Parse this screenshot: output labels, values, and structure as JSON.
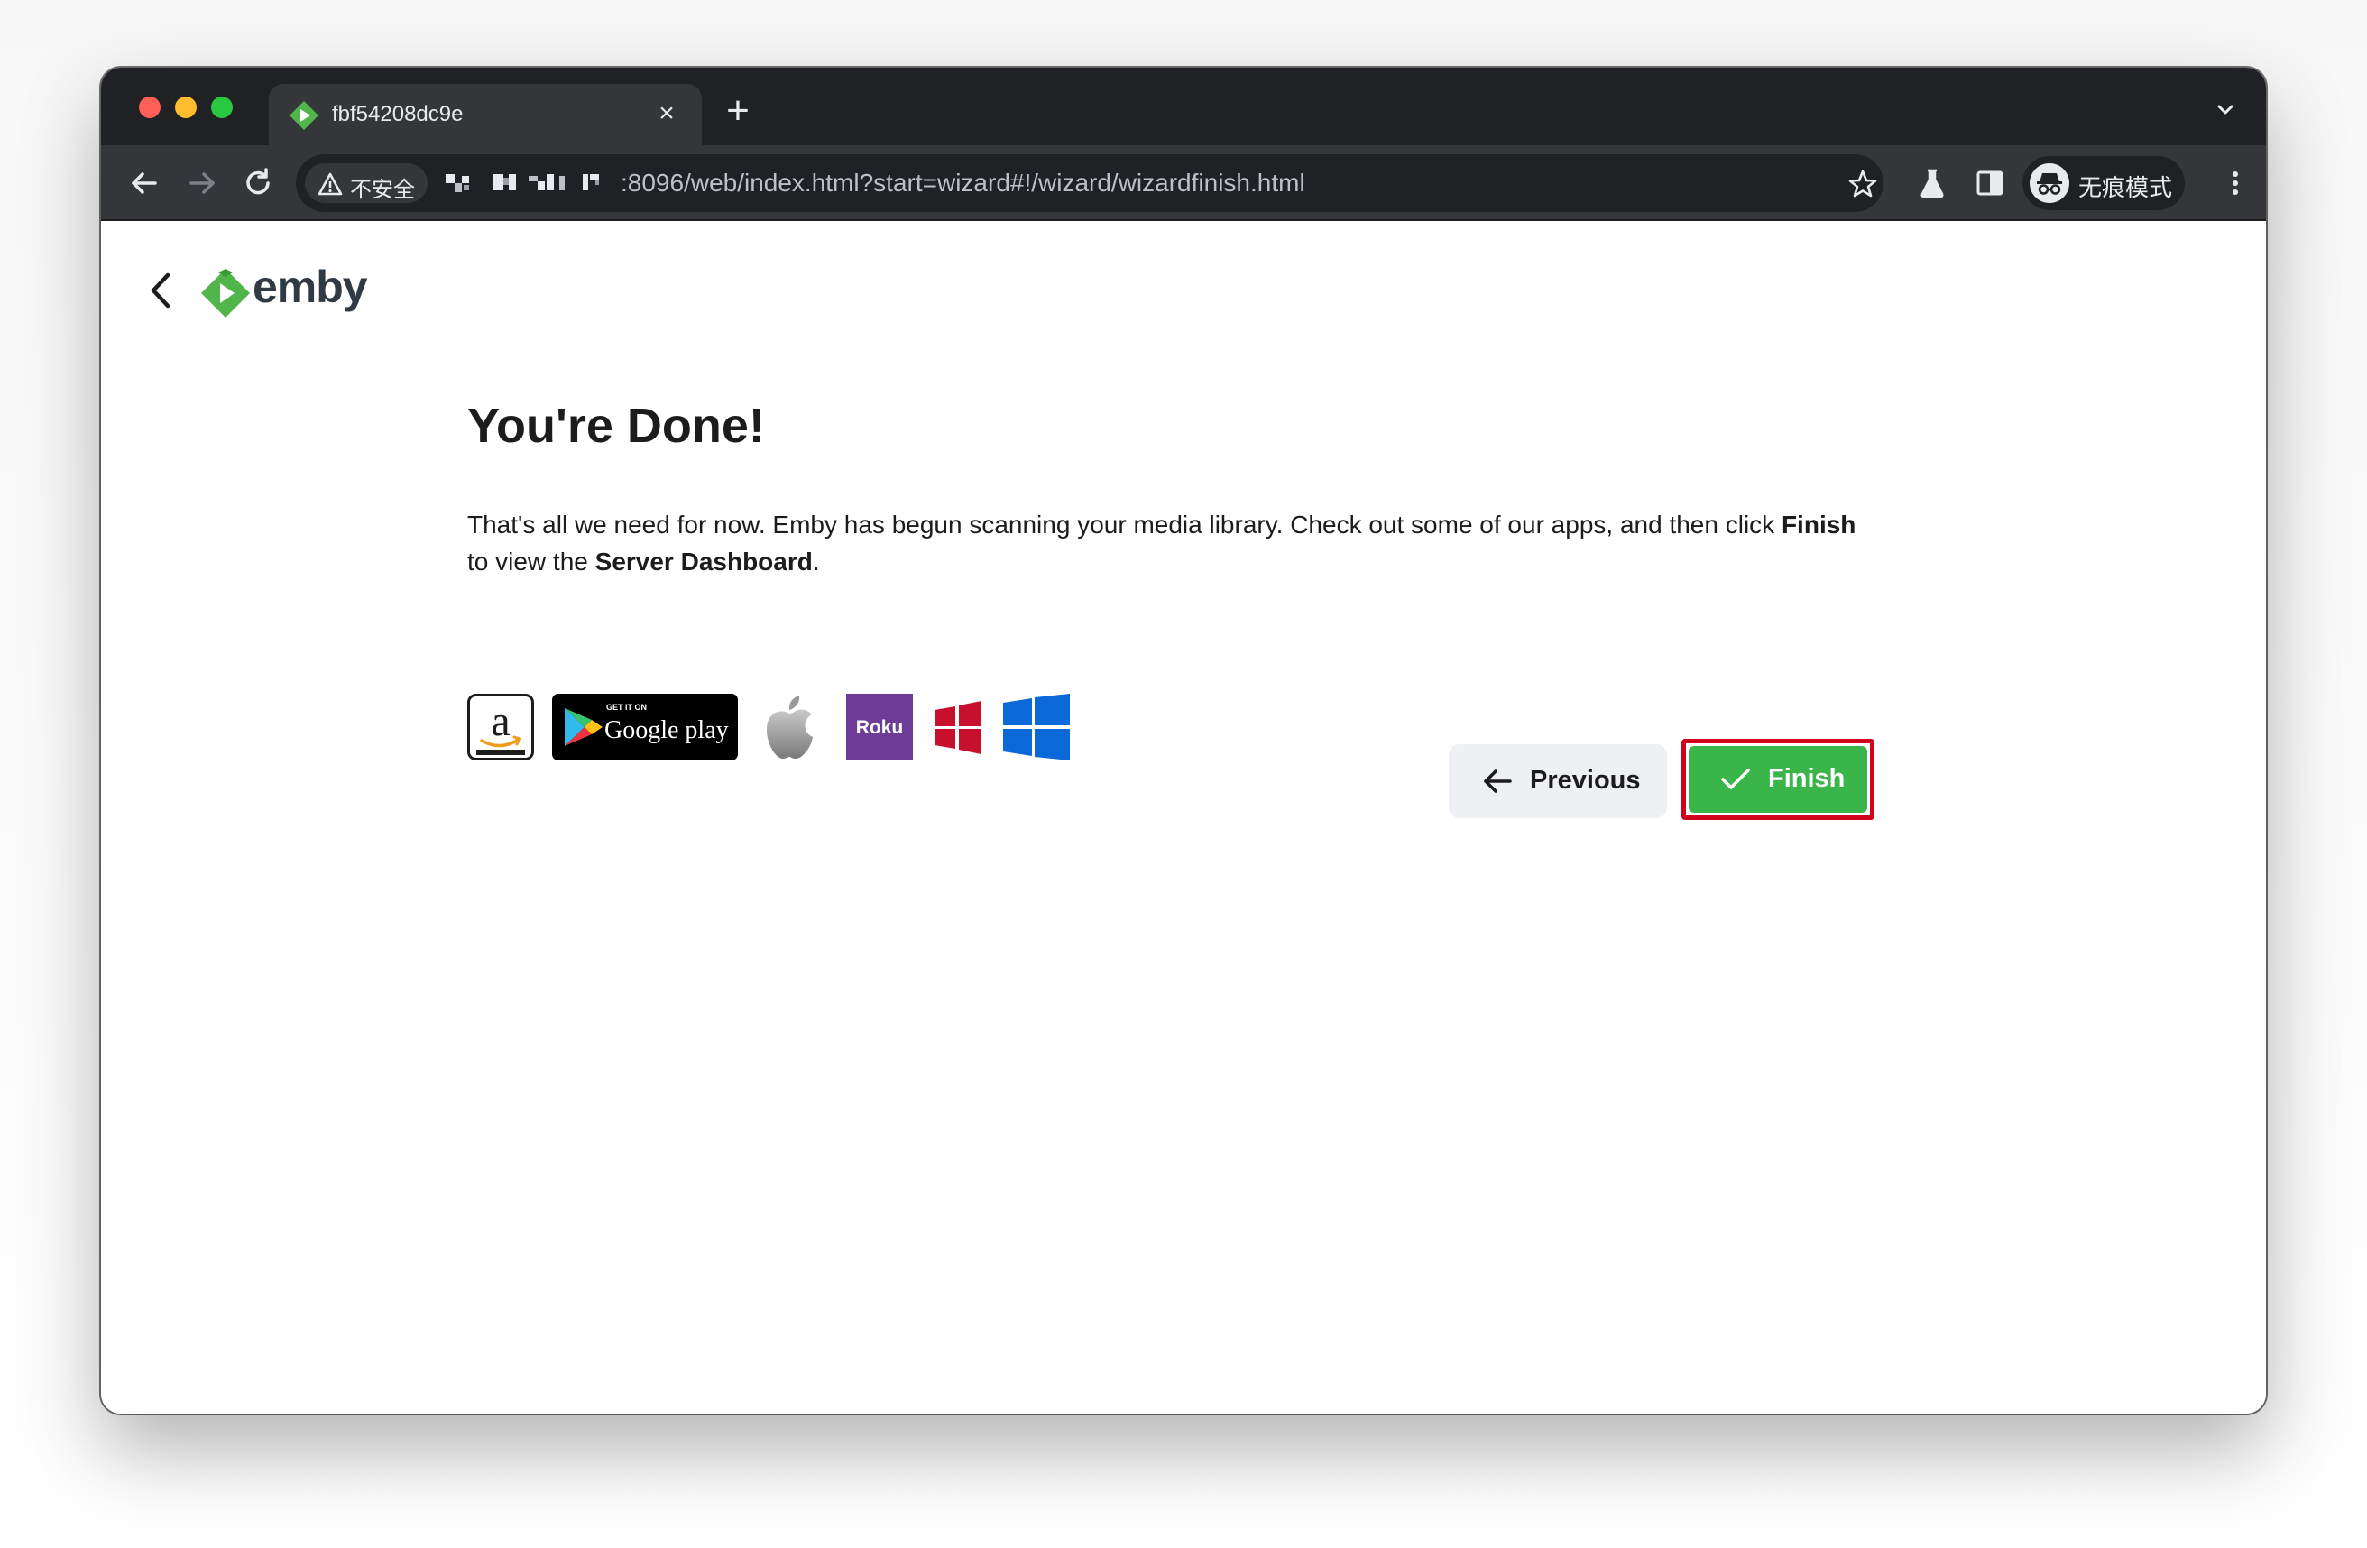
{
  "browser": {
    "tab": {
      "title": "fbf54208dc9e",
      "close_glyph": "×"
    },
    "new_tab_glyph": "+",
    "omnibox": {
      "security_label": "不安全",
      "url": ":8096/web/index.html?start=wizard#!/wizard/wizardfinish.html"
    },
    "profile": {
      "label": "无痕模式"
    }
  },
  "colors": {
    "emby_green": "#52b54b",
    "finish_button": "#3ab54a",
    "highlight_outline": "#d1021b",
    "roku_purple": "#6c3c97",
    "windows_blue": "#0a68d8",
    "windows_red": "#c8102e"
  },
  "header": {
    "logo_text": "emby"
  },
  "wizard": {
    "title": "You're Done!",
    "body_prefix": "That's all we need for now. Emby has begun scanning your media library. Check out some of our apps, and then click ",
    "body_finish_word": "Finish",
    "body_middle": " to view the ",
    "body_dashboard_word": "Server Dashboard",
    "body_suffix": ".",
    "apps": [
      {
        "name": "amazon-appstore-icon"
      },
      {
        "name": "google-play-badge",
        "small_text": "GET IT ON",
        "label": "Google play"
      },
      {
        "name": "apple-icon"
      },
      {
        "name": "roku-icon",
        "label": "Roku"
      },
      {
        "name": "windows-8-icon"
      },
      {
        "name": "windows-10-icon"
      }
    ],
    "buttons": {
      "previous": "Previous",
      "finish": "Finish"
    }
  }
}
